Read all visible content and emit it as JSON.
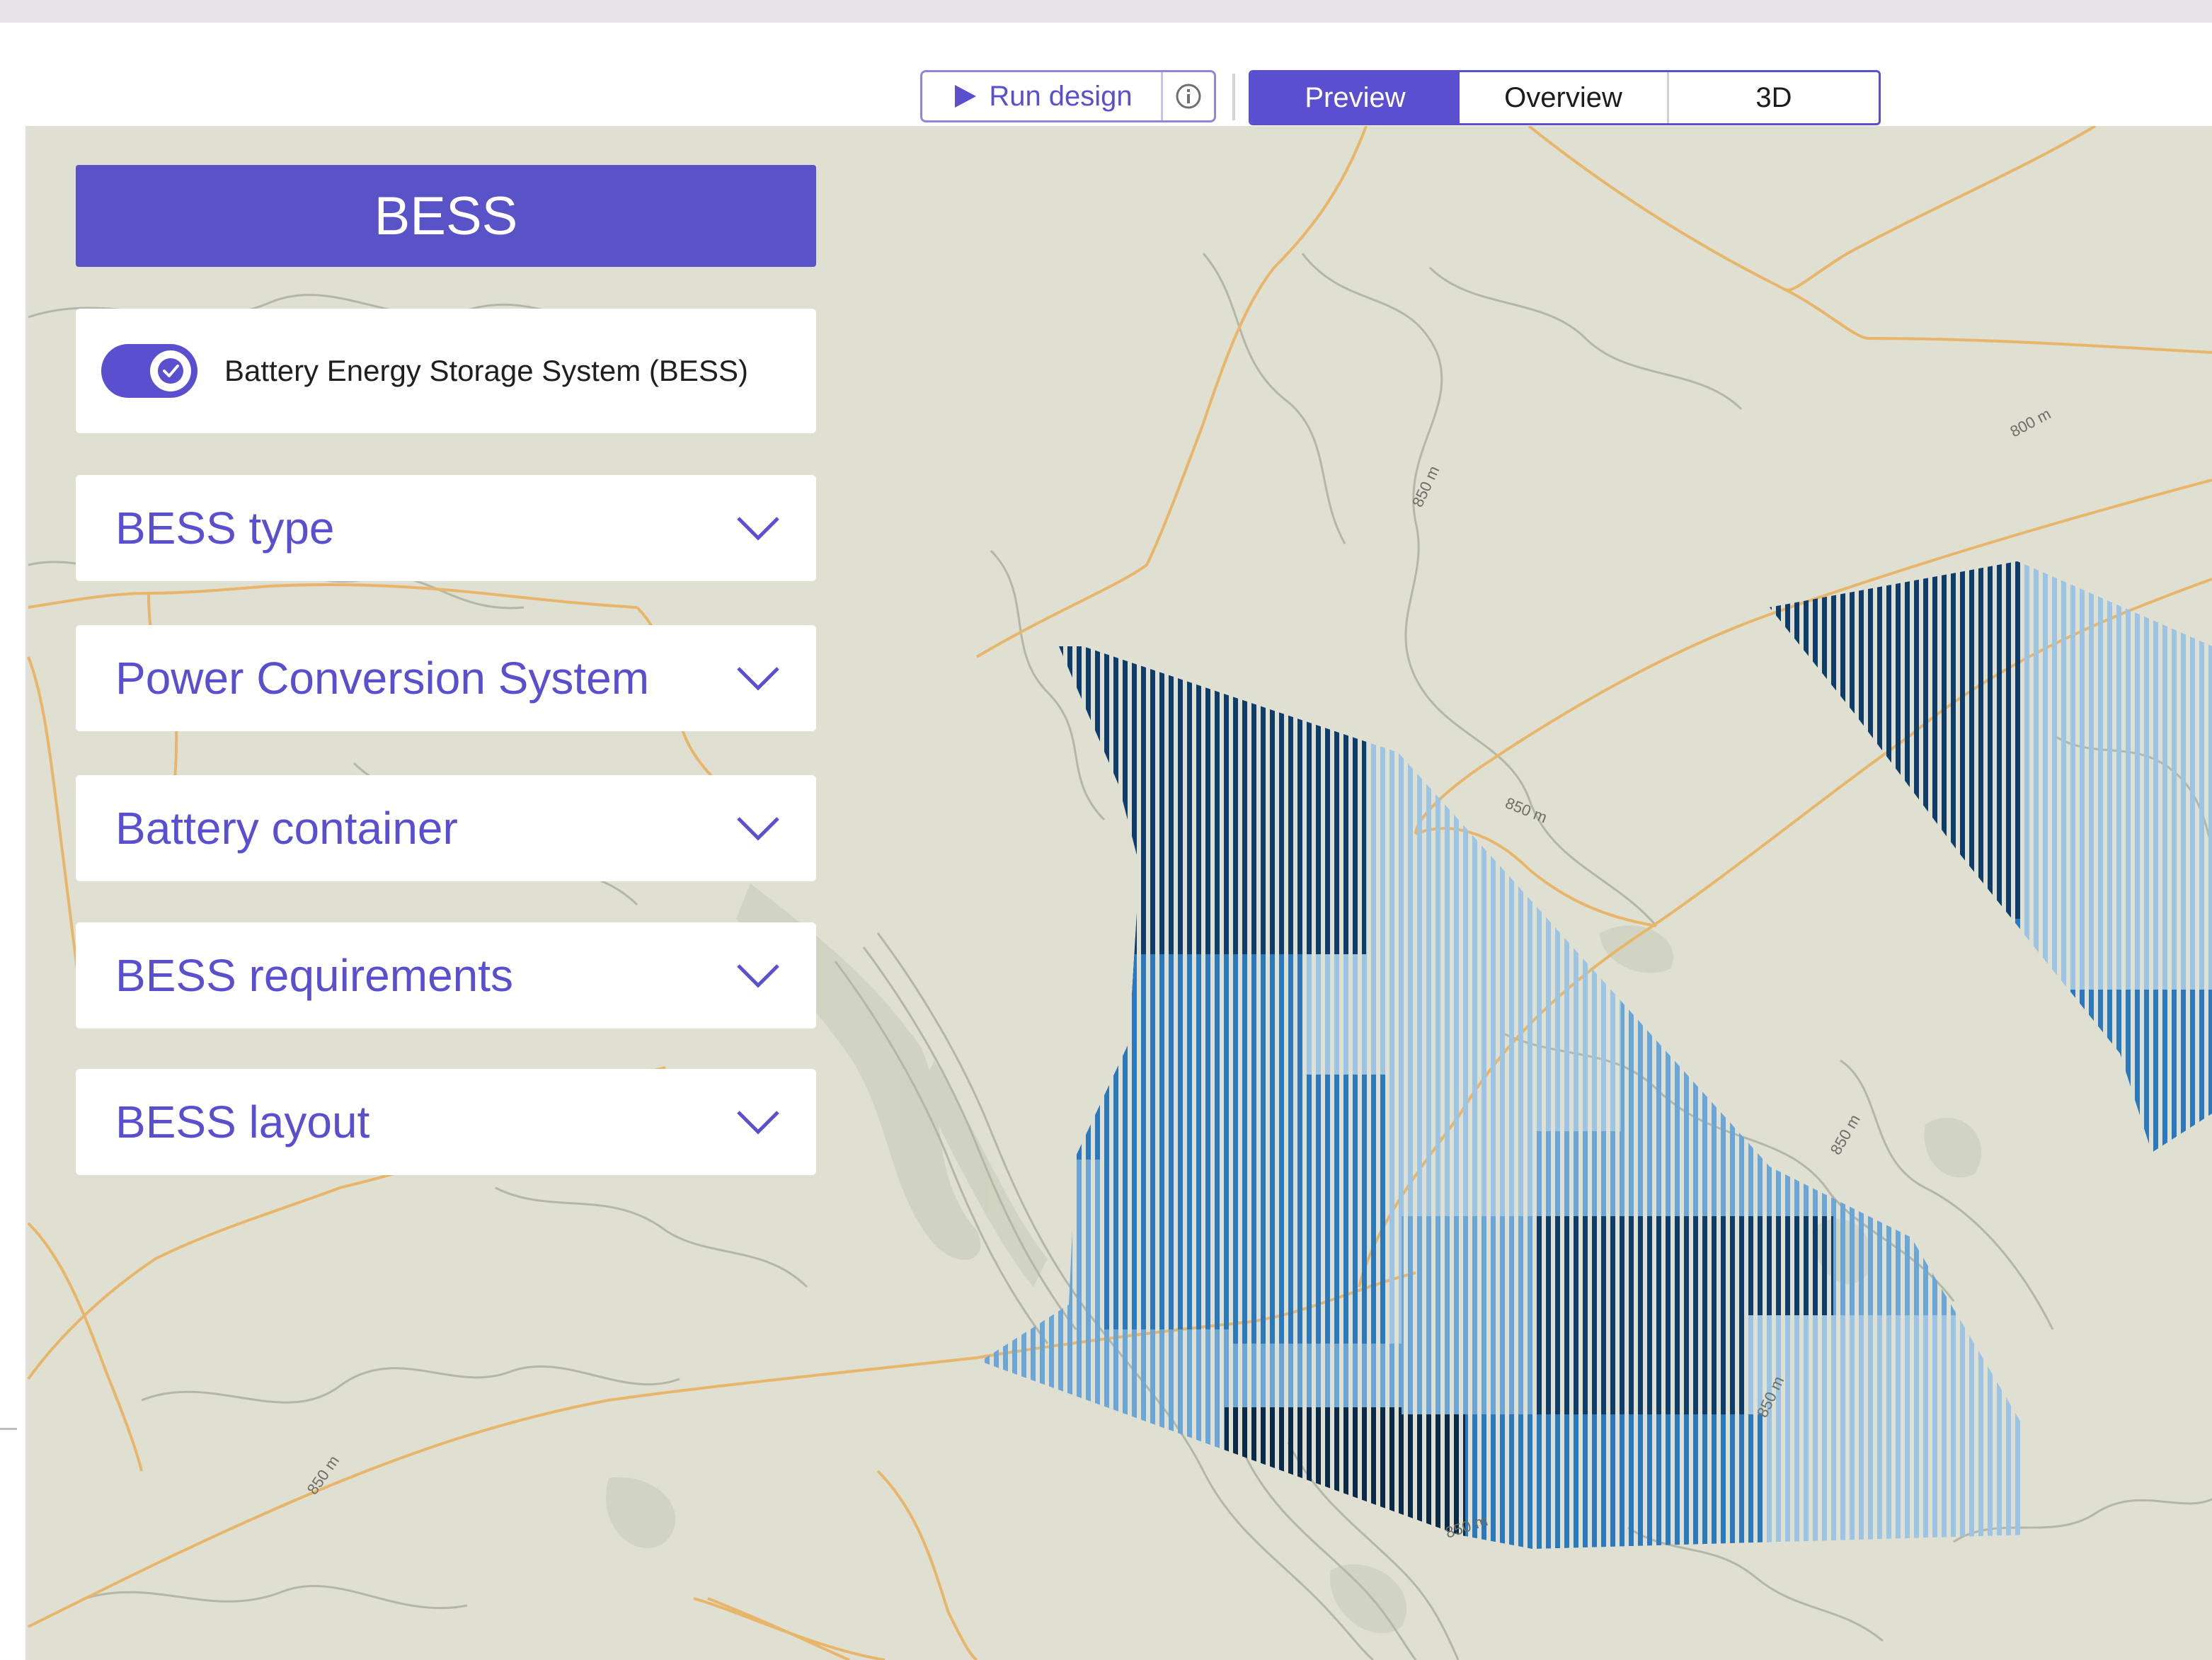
{
  "toolbar": {
    "run_design_label": "Run design",
    "view_tabs": [
      "Preview",
      "Overview",
      "3D"
    ],
    "active_tab": "Preview"
  },
  "panel": {
    "title": "BESS",
    "toggle": {
      "label": "Battery Energy Storage System (BESS)",
      "checked": true
    },
    "sections": [
      "BESS type",
      "Power Conversion System",
      "Battery container",
      "BESS requirements",
      "BESS layout"
    ]
  },
  "map": {
    "contour_labels": [
      "850 m",
      "800 m",
      "850 m",
      "850 m",
      "850 m",
      "850 m",
      "850 m"
    ]
  },
  "colors": {
    "accent": "#5a4fcf",
    "map_background": "#dfdfd2",
    "road": "#e8b66a",
    "stripe_dark": "#0e3d6b",
    "stripe_mid": "#2a78bd",
    "stripe_light": "#9cc4e4"
  }
}
